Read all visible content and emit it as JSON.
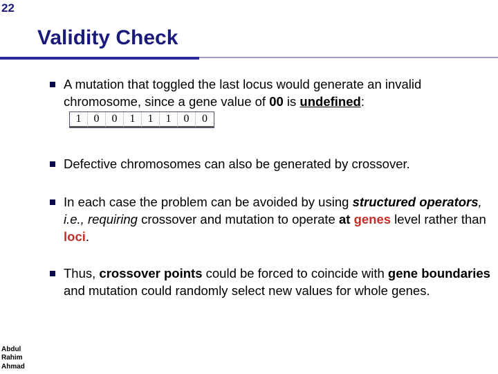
{
  "slide_number": "22",
  "title": "Validity Check",
  "bullets": {
    "b1_pre": "A mutation that toggled the last locus would generate an invalid chromosome, since a gene value of ",
    "b1_val": "00",
    "b1_mid": " is ",
    "b1_undef": "undefined",
    "b1_colon": ":",
    "bits": [
      "1",
      "0",
      "0",
      "1",
      "1",
      "1",
      "0",
      "0"
    ],
    "b2": "Defective chromosomes can also be generated by crossover.",
    "b3_pre": "In each case the problem can be avoided by using ",
    "b3_op": "structured operators",
    "b3_ie": ", i.e., requiring",
    "b3_mid1": " crossover and mutation to operate ",
    "b3_at": "at ",
    "b3_genes": "genes",
    "b3_mid2": " level rather than ",
    "b3_loci": "loci",
    "b3_end": ".",
    "b4_pre": "Thus, ",
    "b4_cp": "crossover points",
    "b4_mid1": " could be forced to coincide with ",
    "b4_gb": "gene boundaries",
    "b4_mid2": " and mutation could randomly select new values for whole genes."
  },
  "author": {
    "l1": "Abdul",
    "l2": "Rahim",
    "l3": "Ahmad"
  }
}
